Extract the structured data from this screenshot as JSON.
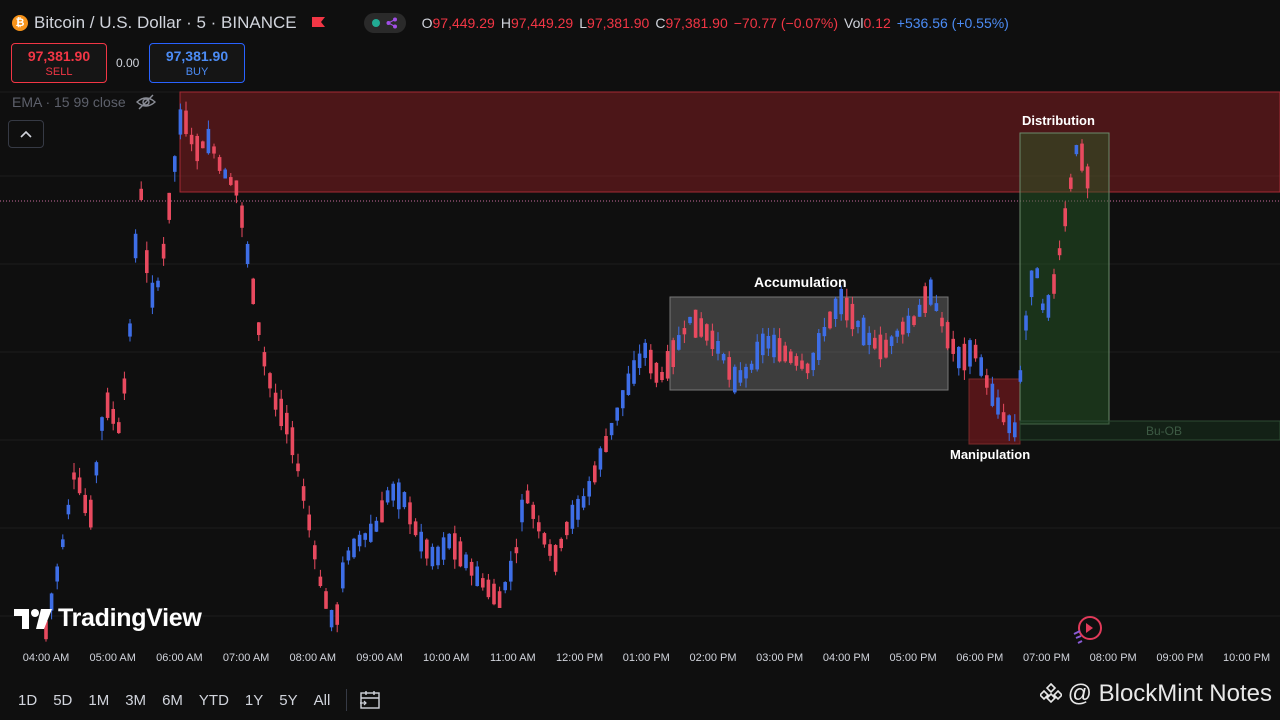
{
  "header": {
    "symbol_title": "Bitcoin / U.S. Dollar · 5 · BINANCE",
    "ohlc": {
      "o_label": "O",
      "o": "97,449.29",
      "h_label": "H",
      "h": "97,449.29",
      "l_label": "L",
      "l": "97,381.90",
      "c_label": "C",
      "c": "97,381.90",
      "change": "−70.77 (−0.07%)",
      "vol_label": "Vol",
      "vol": "0.12",
      "vol_change": "+536.56 (+0.55%)"
    }
  },
  "trade": {
    "sell_price": "97,381.90",
    "sell_label": "SELL",
    "spread": "0.00",
    "buy_price": "97,381.90",
    "buy_label": "BUY"
  },
  "indicator": {
    "ema_label": "EMA · 15 99 close"
  },
  "annotations": {
    "accumulation": "Accumulation",
    "manipulation": "Manipulation",
    "distribution": "Distribution",
    "order_block": "Bu-OB"
  },
  "branding": {
    "tradingview": "TradingView",
    "watermark": "@ BlockMint Notes"
  },
  "time_axis": [
    "04:00 AM",
    "05:00 AM",
    "06:00 AM",
    "07:00 AM",
    "08:00 AM",
    "09:00 AM",
    "10:00 AM",
    "11:00 AM",
    "12:00 PM",
    "01:00 PM",
    "02:00 PM",
    "03:00 PM",
    "04:00 PM",
    "05:00 PM",
    "06:00 PM",
    "07:00 PM",
    "08:00 PM",
    "09:00 PM",
    "10:00 PM"
  ],
  "ranges": [
    "1D",
    "5D",
    "1M",
    "3M",
    "6M",
    "YTD",
    "1Y",
    "5Y",
    "All"
  ],
  "colors": {
    "up": "#3e6ee6",
    "down": "#e84a5f",
    "background": "#0f0f0f"
  },
  "icons": [
    "bitcoin-icon",
    "flag-icon",
    "eye-off-icon",
    "chevron-up-icon",
    "calendar-icon",
    "binance-icon",
    "replay-icon"
  ]
}
